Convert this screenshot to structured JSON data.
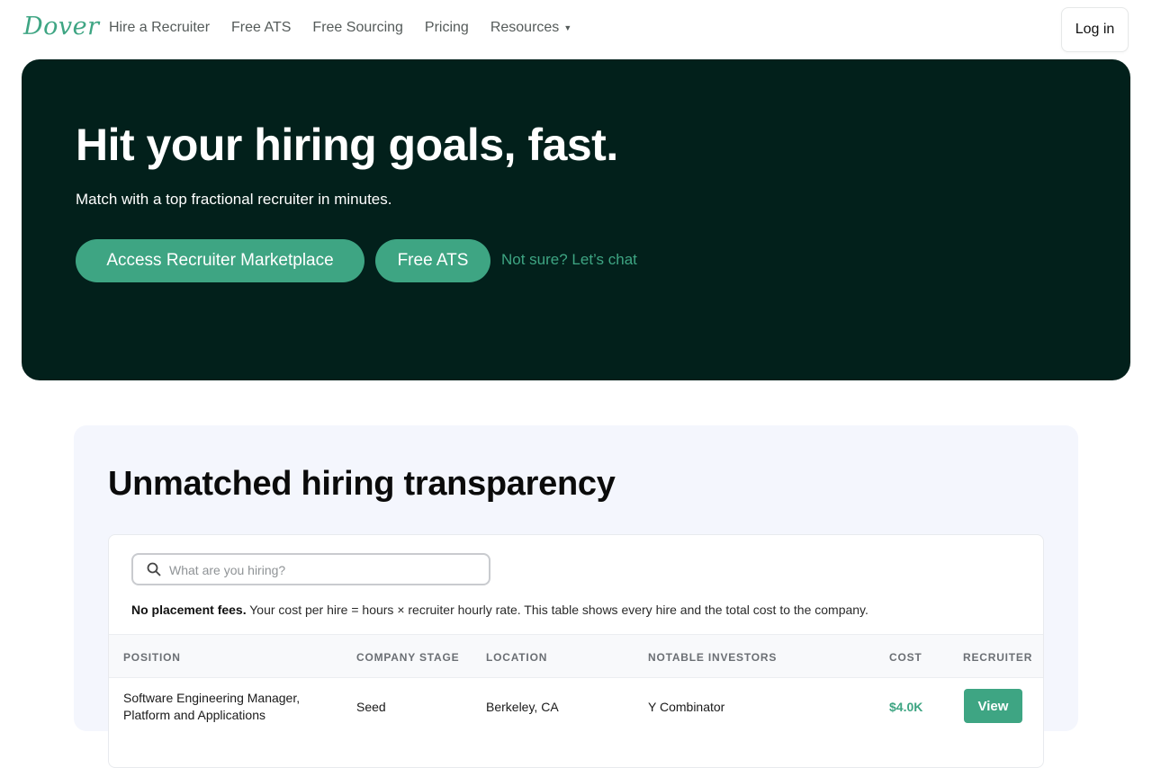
{
  "nav": {
    "logo": "Dover",
    "links": [
      "Hire a Recruiter",
      "Free ATS",
      "Free Sourcing",
      "Pricing",
      "Resources"
    ],
    "login_label": "Log in"
  },
  "hero": {
    "title": "Hit your hiring goals, fast.",
    "subtitle": "Match with a top fractional recruiter in minutes.",
    "primary_cta": "Access Recruiter Marketplace",
    "secondary_cta": "Free ATS",
    "chat_link": "Not sure? Let’s chat"
  },
  "transparency": {
    "title": "Unmatched hiring transparency",
    "search_placeholder": "What are you hiring?",
    "note_bold": "No placement fees.",
    "note_text": " Your cost per hire = hours × recruiter hourly rate. This table shows every hire and the total cost to the company.",
    "columns": [
      "POSITION",
      "COMPANY STAGE",
      "LOCATION",
      "NOTABLE INVESTORS",
      "COST",
      "RECRUITER"
    ],
    "rows": [
      {
        "position_line1": "Software Engineering Manager,",
        "position_line2": "Platform and Applications",
        "stage": "Seed",
        "location": "Berkeley, CA",
        "investors": "Y Combinator",
        "cost": "$4.0K",
        "action": "View"
      }
    ]
  },
  "colors": {
    "brand_green": "#3ea583",
    "hero_bg": "#02201b",
    "section_bg": "#f4f6fd"
  },
  "icons": {
    "search": "search-icon",
    "resources_dropdown": "caret-down-icon"
  }
}
